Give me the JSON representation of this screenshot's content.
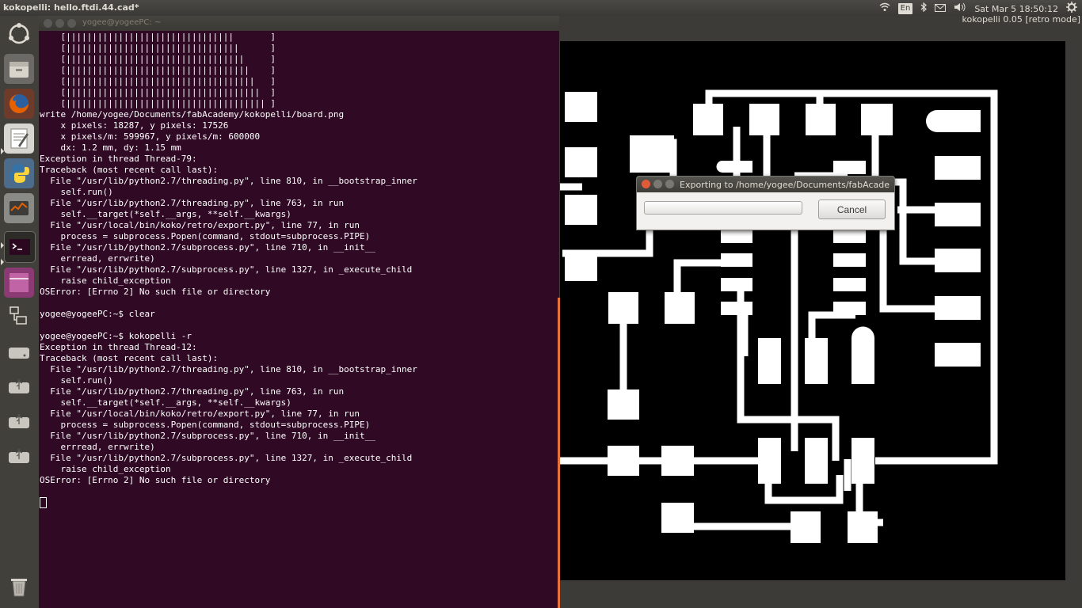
{
  "topbar": {
    "window_title": "kokopelli: hello.ftdi.44.cad*",
    "language": "En",
    "clock": "Sat Mar 5 18:50:12"
  },
  "launcher": {
    "items": [
      {
        "name": "dash-home-icon"
      },
      {
        "name": "files-icon"
      },
      {
        "name": "firefox-icon"
      },
      {
        "name": "text-editor-icon"
      },
      {
        "name": "python-icon"
      },
      {
        "name": "system-monitor-icon"
      },
      {
        "name": "terminal-icon"
      },
      {
        "name": "workspace-switcher-icon"
      },
      {
        "name": "network-icon"
      },
      {
        "name": "drive-icon"
      },
      {
        "name": "usb-drive-icon"
      },
      {
        "name": "usb-drive-icon-2"
      },
      {
        "name": "usb-drive-icon-3"
      },
      {
        "name": "trash-icon"
      }
    ]
  },
  "terminal": {
    "title": "yogee@yogeePC: ~",
    "lines": [
      "    [||||||||||||||||||||||||||||||||       ]",
      "    [|||||||||||||||||||||||||||||||||      ]",
      "    [||||||||||||||||||||||||||||||||||     ]",
      "    [|||||||||||||||||||||||||||||||||||    ]",
      "    [||||||||||||||||||||||||||||||||||||   ]",
      "    [|||||||||||||||||||||||||||||||||||||  ]",
      "    [|||||||||||||||||||||||||||||||||||||| ]",
      "write /home/yogee/Documents/fabAcademy/kokopelli/board.png",
      "    x pixels: 18287, y pixels: 17526",
      "    x pixels/m: 599967, y pixels/m: 600000",
      "    dx: 1.2 mm, dy: 1.15 mm",
      "Exception in thread Thread-79:",
      "Traceback (most recent call last):",
      "  File \"/usr/lib/python2.7/threading.py\", line 810, in __bootstrap_inner",
      "    self.run()",
      "  File \"/usr/lib/python2.7/threading.py\", line 763, in run",
      "    self.__target(*self.__args, **self.__kwargs)",
      "  File \"/usr/local/bin/koko/retro/export.py\", line 77, in run",
      "    process = subprocess.Popen(command, stdout=subprocess.PIPE)",
      "  File \"/usr/lib/python2.7/subprocess.py\", line 710, in __init__",
      "    errread, errwrite)",
      "  File \"/usr/lib/python2.7/subprocess.py\", line 1327, in _execute_child",
      "    raise child_exception",
      "OSError: [Errno 2] No such file or directory",
      "",
      "yogee@yogeePC:~$ clear",
      "",
      "yogee@yogeePC:~$ kokopelli -r",
      "Exception in thread Thread-12:",
      "Traceback (most recent call last):",
      "  File \"/usr/lib/python2.7/threading.py\", line 810, in __bootstrap_inner",
      "    self.run()",
      "  File \"/usr/lib/python2.7/threading.py\", line 763, in run",
      "    self.__target(*self.__args, **self.__kwargs)",
      "  File \"/usr/local/bin/koko/retro/export.py\", line 77, in run",
      "    process = subprocess.Popen(command, stdout=subprocess.PIPE)",
      "  File \"/usr/lib/python2.7/subprocess.py\", line 710, in __init__",
      "    errread, errwrite)",
      "  File \"/usr/lib/python2.7/subprocess.py\", line 1327, in _execute_child",
      "    raise child_exception",
      "OSError: [Errno 2] No such file or directory",
      ""
    ]
  },
  "viewer": {
    "label": "kokopelli 0.05 [retro mode]"
  },
  "dialog": {
    "title": "Exporting to /home/yogee/Documents/fabAcademy/kokopelli/board.png",
    "progress": 0,
    "cancel_label": "Cancel"
  },
  "colors": {
    "terminal_bg": "#300a24",
    "accent": "#e9713b",
    "panel": "#3c3b37"
  }
}
